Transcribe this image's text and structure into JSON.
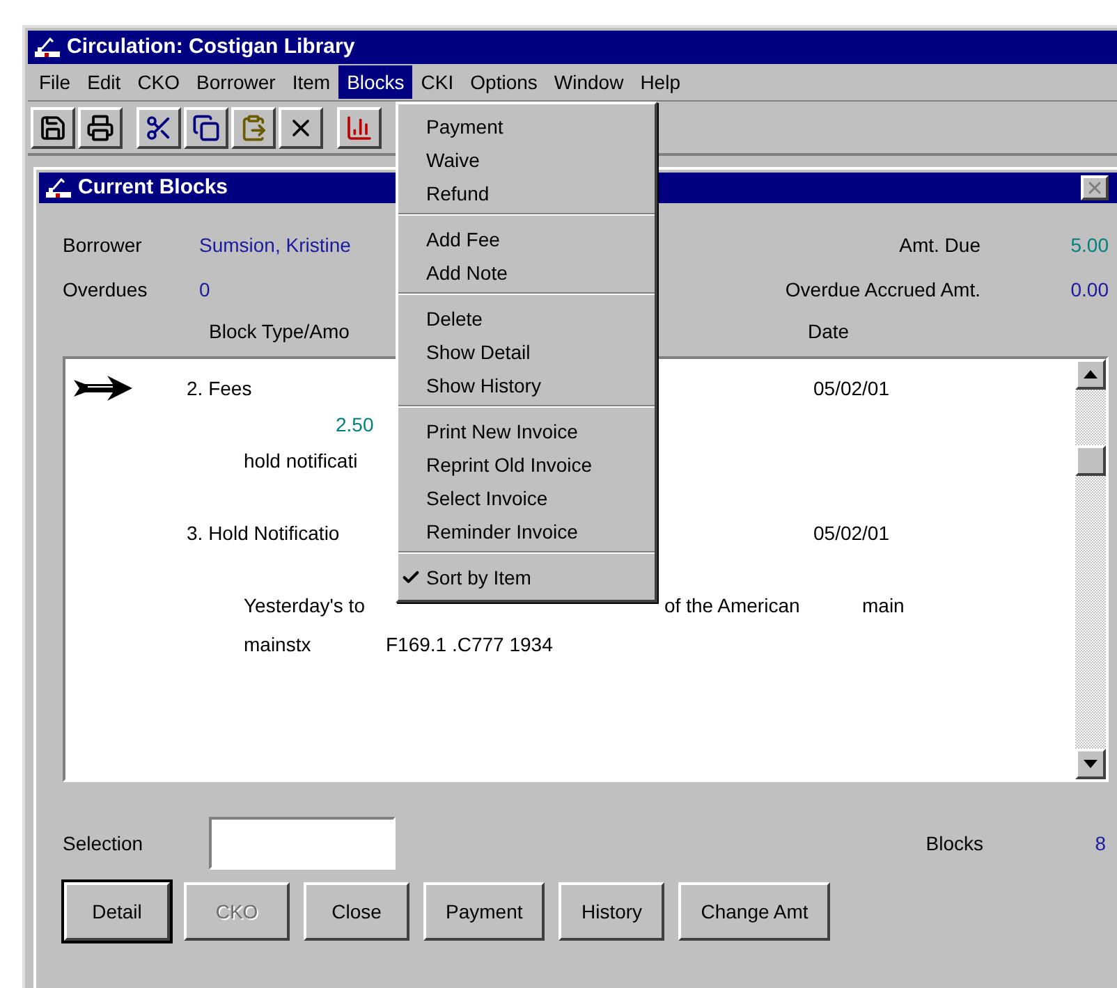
{
  "window": {
    "title": "Circulation: Costigan Library"
  },
  "menu_bar": [
    {
      "label": "File",
      "selected": false
    },
    {
      "label": "Edit",
      "selected": false
    },
    {
      "label": "CKO",
      "selected": false
    },
    {
      "label": "Borrower",
      "selected": false
    },
    {
      "label": "Item",
      "selected": false
    },
    {
      "label": "Blocks",
      "selected": true
    },
    {
      "label": "CKI",
      "selected": false
    },
    {
      "label": "Options",
      "selected": false
    },
    {
      "label": "Window",
      "selected": false
    },
    {
      "label": "Help",
      "selected": false
    }
  ],
  "toolbar": [
    [
      {
        "kind": "save"
      },
      {
        "kind": "print"
      }
    ],
    [
      {
        "kind": "cut"
      },
      {
        "kind": "copy"
      },
      {
        "kind": "paste"
      },
      {
        "kind": "delete"
      }
    ],
    [
      {
        "kind": "chart"
      }
    ]
  ],
  "blocks_menu": [
    [
      {
        "label": "Payment",
        "checked": false
      },
      {
        "label": "Waive",
        "checked": false
      },
      {
        "label": "Refund",
        "checked": false
      }
    ],
    [
      {
        "label": "Add Fee",
        "checked": false
      },
      {
        "label": "Add Note",
        "checked": false
      }
    ],
    [
      {
        "label": "Delete",
        "checked": false
      },
      {
        "label": "Show Detail",
        "checked": false
      },
      {
        "label": "Show History",
        "checked": false
      }
    ],
    [
      {
        "label": "Print New Invoice",
        "checked": false
      },
      {
        "label": "Reprint Old Invoice",
        "checked": false
      },
      {
        "label": "Select Invoice",
        "checked": false
      },
      {
        "label": "Reminder Invoice",
        "checked": false
      }
    ],
    [
      {
        "label": "Sort by Item",
        "checked": true
      }
    ]
  ],
  "child_window": {
    "title": "Current Blocks",
    "borrower": {
      "label": "Borrower",
      "value": "Sumsion, Kristine"
    },
    "overdues": {
      "label": "Overdues",
      "value": "0"
    },
    "amt_due": {
      "label": "Amt. Due",
      "value": "5.00"
    },
    "overdue_accrued": {
      "label": "Overdue Accrued Amt.",
      "value": "0.00"
    },
    "columns": [
      "Block Type/Amo",
      "Date"
    ],
    "entries": [
      {
        "title": "2. Fees",
        "date": "05/02/01",
        "selected": true,
        "amount": "2.50",
        "lines": [
          [
            "hold notificati"
          ]
        ]
      },
      {
        "title": "3. Hold Notificatio",
        "date": "05/02/01",
        "selected": false,
        "lines": [
          [
            "Yesterday's to",
            "of the American",
            "main"
          ],
          [
            "mainstx",
            "F169.1 .C777 1934"
          ]
        ]
      }
    ],
    "selection": {
      "label": "Selection"
    },
    "blocks_count": {
      "label": "Blocks",
      "value": "8"
    },
    "buttons": [
      {
        "label": "Detail",
        "default": true,
        "disabled": false
      },
      {
        "label": "CKO",
        "default": false,
        "disabled": true
      },
      {
        "label": "Close",
        "default": false,
        "disabled": false
      },
      {
        "label": "Payment",
        "default": false,
        "disabled": false
      },
      {
        "label": "History",
        "default": false,
        "disabled": false
      },
      {
        "label": "Change Amt",
        "default": false,
        "disabled": false
      }
    ]
  }
}
